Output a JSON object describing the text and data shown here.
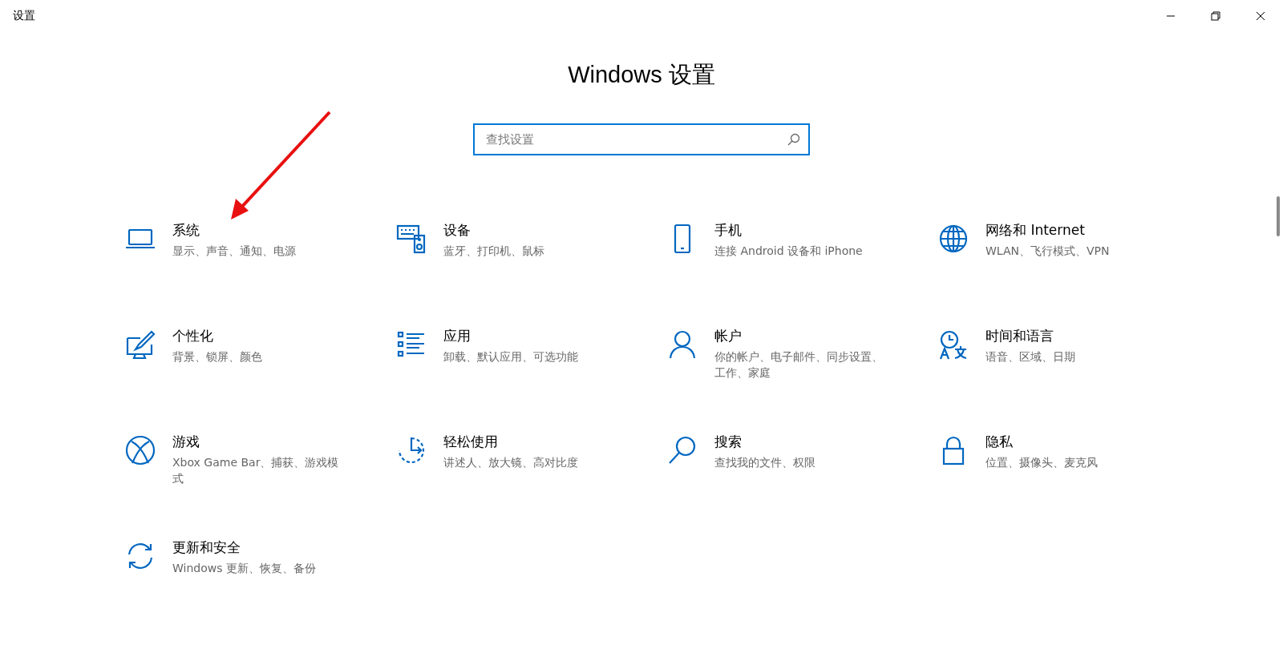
{
  "window": {
    "title": "设置"
  },
  "heading": "Windows 设置",
  "search": {
    "placeholder": "查找设置"
  },
  "categories": [
    {
      "title": "系统",
      "description": "显示、声音、通知、电源"
    },
    {
      "title": "设备",
      "description": "蓝牙、打印机、鼠标"
    },
    {
      "title": "手机",
      "description": "连接 Android 设备和 iPhone"
    },
    {
      "title": "网络和 Internet",
      "description": "WLAN、飞行模式、VPN"
    },
    {
      "title": "个性化",
      "description": "背景、锁屏、颜色"
    },
    {
      "title": "应用",
      "description": "卸载、默认应用、可选功能"
    },
    {
      "title": "帐户",
      "description": "你的帐户、电子邮件、同步设置、工作、家庭"
    },
    {
      "title": "时间和语言",
      "description": "语音、区域、日期"
    },
    {
      "title": "游戏",
      "description": "Xbox Game Bar、捕获、游戏模式"
    },
    {
      "title": "轻松使用",
      "description": "讲述人、放大镜、高对比度"
    },
    {
      "title": "搜索",
      "description": "查找我的文件、权限"
    },
    {
      "title": "隐私",
      "description": "位置、摄像头、麦克风"
    },
    {
      "title": "更新和安全",
      "description": "Windows 更新、恢复、备份"
    }
  ]
}
